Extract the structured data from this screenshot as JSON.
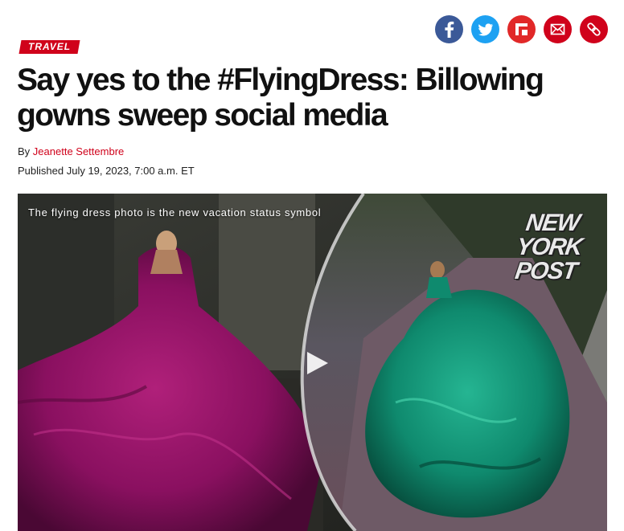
{
  "share": {
    "buttons": [
      {
        "name": "facebook",
        "color": "#3b5998"
      },
      {
        "name": "twitter",
        "color": "#1da1f2"
      },
      {
        "name": "flipboard",
        "color": "#e12828"
      },
      {
        "name": "email",
        "color": "#d0021b"
      },
      {
        "name": "copy-link",
        "color": "#d0021b"
      }
    ]
  },
  "article": {
    "section": "TRAVEL",
    "headline_line1": "Say yes to the #FlyingDress: Billowing",
    "headline_line2": "gowns sweep social media",
    "byline_prefix": "By",
    "author": "Jeanette Settembre",
    "published": "Published July 19, 2023, 7:00 a.m. ET"
  },
  "video": {
    "title": "The flying dress photo is the new vacation status symbol",
    "logo_lines": [
      "NEW",
      "YORK",
      "POST"
    ]
  },
  "colors": {
    "brand_red": "#d0021b",
    "magenta_dress": "#8a1060",
    "teal_dress": "#0f8a6e"
  }
}
